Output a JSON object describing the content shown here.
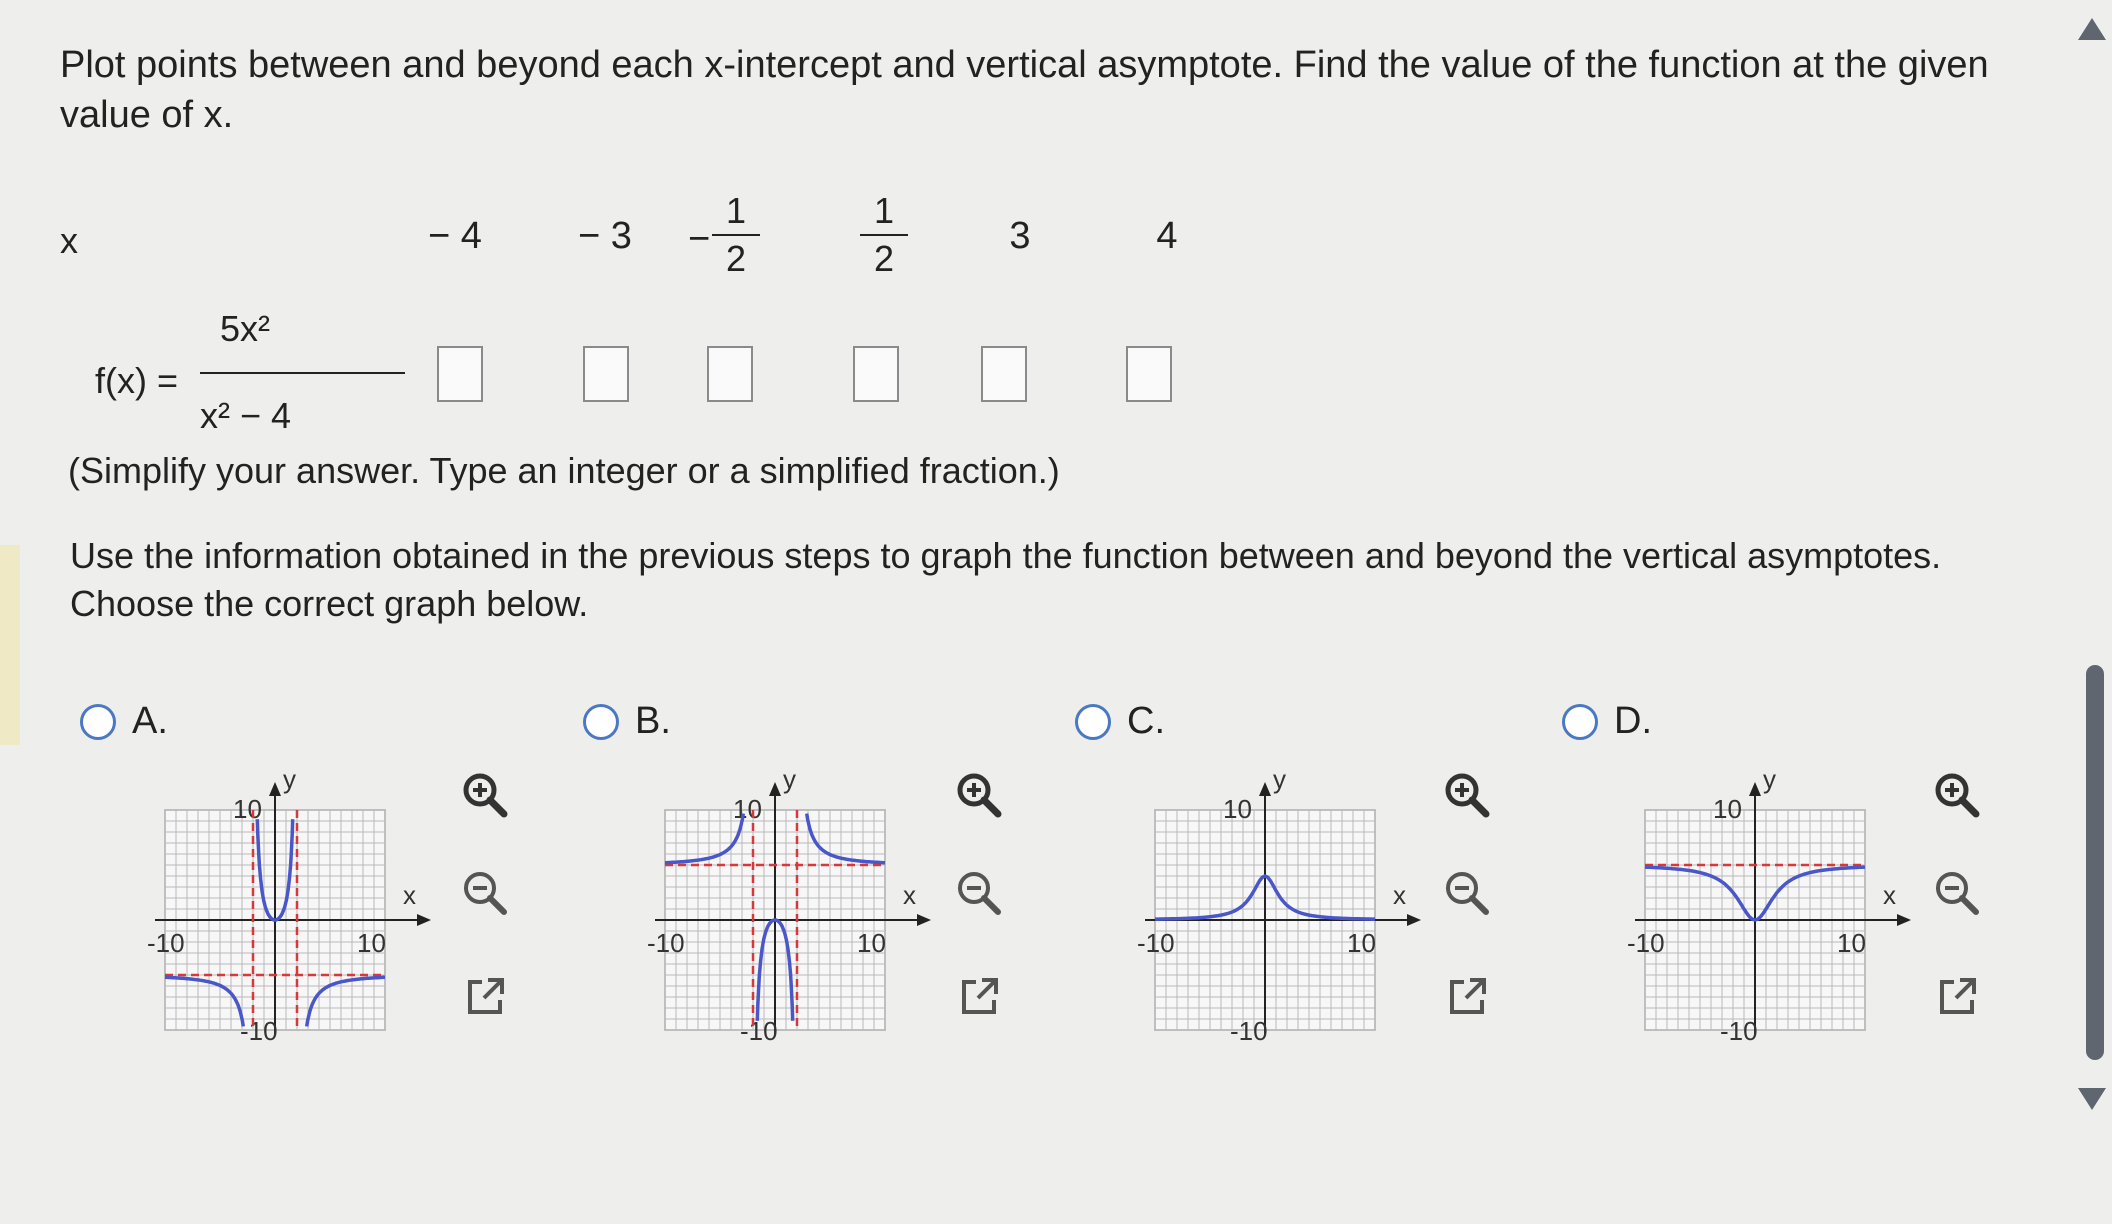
{
  "prompt": "Plot points between and beyond each x-intercept and vertical asymptote. Find the value of the function at the given value of x.",
  "table": {
    "x_label": "x",
    "x_values": [
      "− 4",
      "− 3",
      "1/2 (negative)",
      "1/2",
      "3",
      "4"
    ],
    "neg_four": "− 4",
    "neg_three": "− 3",
    "neg_half_sign": "−",
    "half_num": "1",
    "half_den": "2",
    "three": "3",
    "four": "4",
    "function_label": "f(x) =",
    "function_numerator": "5x²",
    "function_denominator": "x² − 4",
    "answers": [
      "",
      "",
      "",
      "",
      "",
      ""
    ]
  },
  "hint": "(Simplify your answer. Type an integer or a simplified fraction.)",
  "instruction": "Use the information obtained in the previous steps to graph the function between and beyond the vertical asymptotes. Choose the correct graph below.",
  "options": [
    {
      "letter": "A.",
      "selected": false
    },
    {
      "letter": "B.",
      "selected": false
    },
    {
      "letter": "C.",
      "selected": false
    },
    {
      "letter": "D.",
      "selected": false
    }
  ],
  "graph_labels": {
    "y": "y",
    "x": "x",
    "ten": "10",
    "neg_ten": "-10"
  },
  "icons": {
    "zoom_in": "zoom-in-icon",
    "zoom_out": "zoom-out-icon",
    "popout": "external-link-icon"
  },
  "colors": {
    "accent": "#4a78c2",
    "curve": "#4a57c8",
    "asymptote": "#d9383a",
    "grid": "#b9b9b9"
  }
}
